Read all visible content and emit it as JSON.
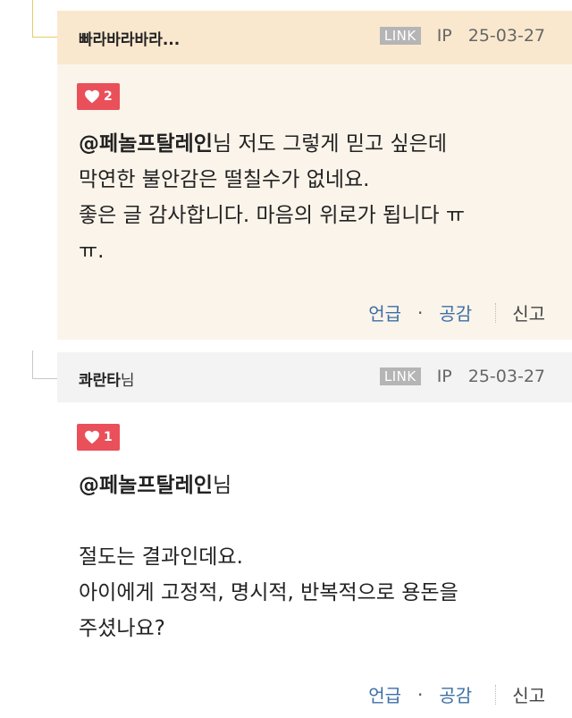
{
  "comments": [
    {
      "author": "빠라바라바라...",
      "author_suffix": "",
      "link_badge": "LINK",
      "ip": "IP",
      "date": "25-03-27",
      "likes": "2",
      "mention": "@페놀프탈레인",
      "mention_suffix": "님 저도 그렇게 믿고 싶은데",
      "lines": [
        "막연한 불안감은 떨칠수가 없네요.",
        "좋은 글 감사합니다. 마음의 위로가 됩니다 ㅠ",
        "ㅠ."
      ],
      "actions": {
        "mention": "언급",
        "dot": "·",
        "empathy": "공감",
        "report": "신고"
      }
    },
    {
      "author": "콰란타",
      "author_suffix": "님",
      "link_badge": "LINK",
      "ip": "IP",
      "date": "25-03-27",
      "likes": "1",
      "mention": "@페놀프탈레인",
      "mention_suffix": "님",
      "lines": [
        "절도는 결과인데요.",
        "아이에게 고정적, 명시적, 반복적으로 용돈을",
        "주셨나요?"
      ],
      "actions": {
        "mention": "언급",
        "dot": "·",
        "empathy": "공감",
        "report": "신고"
      }
    }
  ],
  "colors": {
    "like_badge": "#e9505a",
    "action_link": "#3d6fa5",
    "reply_head_bg": "#fae8ce",
    "reply_body_bg": "#fbf4ea"
  }
}
